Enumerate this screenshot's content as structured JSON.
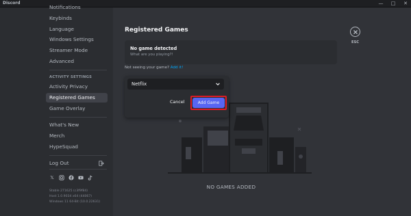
{
  "window": {
    "title": "Discord",
    "minimize": "—",
    "maximize": "□",
    "close": "✕"
  },
  "sidebar": {
    "items_top": [
      {
        "label": "Notifications"
      },
      {
        "label": "Keybinds"
      },
      {
        "label": "Language"
      },
      {
        "label": "Windows Settings"
      },
      {
        "label": "Streamer Mode"
      },
      {
        "label": "Advanced"
      }
    ],
    "activity_header": "ACTIVITY SETTINGS",
    "activity_items": [
      {
        "label": "Activity Privacy"
      },
      {
        "label": "Registered Games",
        "selected": true
      },
      {
        "label": "Game Overlay"
      }
    ],
    "misc_items": [
      {
        "label": "What's New"
      },
      {
        "label": "Merch"
      },
      {
        "label": "HypeSquad"
      }
    ],
    "logout": "Log Out",
    "socials": [
      "x-icon",
      "instagram-icon",
      "facebook-icon",
      "youtube-icon",
      "tiktok-icon"
    ],
    "version_lines": [
      "Stable 271625 (c3f9f84)",
      "Host 1.0.9034 x64 (44067)",
      "Windows 11 64-Bit (10.0.22631)"
    ]
  },
  "main": {
    "title": "Registered Games",
    "detect_title": "No game detected",
    "detect_sub": "What are you playing?!",
    "not_seeing_prefix": "Not seeing your game?",
    "add_it_link": "Add it!",
    "popup": {
      "selected_game": "Netflix",
      "cancel_label": "Cancel",
      "add_label": "Add Game"
    },
    "empty_label": "NO GAMES ADDED"
  },
  "close_panel": {
    "esc_label": "ESC"
  },
  "colors": {
    "accent": "#5865f2",
    "highlight": "#e01b24",
    "link": "#00a8fc"
  }
}
